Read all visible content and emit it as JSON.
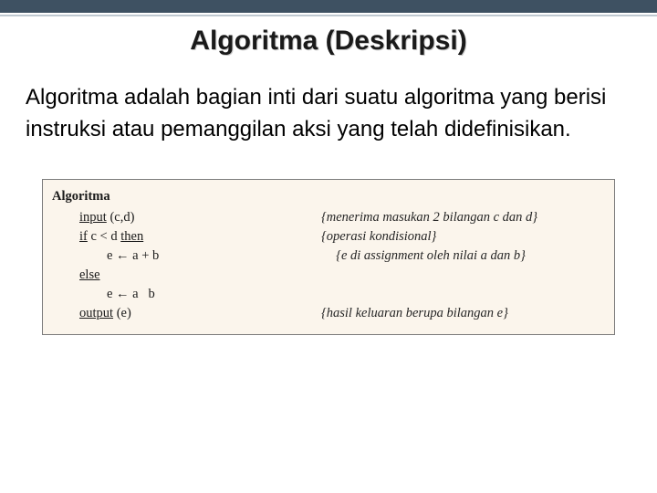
{
  "title": "Algoritma (Deskripsi)",
  "paragraph": "Algoritma adalah bagian inti dari suatu algoritma yang berisi instruksi atau pemanggilan aksi yang telah didefinisikan.",
  "code": {
    "header": "Algoritma",
    "lines": [
      {
        "kw": "input",
        "rest": " (c,d)",
        "comment": "{menerima masukan 2 bilangan c dan d}",
        "indent": 1
      },
      {
        "kw": "if",
        "rest": " c < d ",
        "kw2": "then",
        "comment": "{operasi kondisional}",
        "indent": 1
      },
      {
        "kw": "",
        "rest": "e ← a + b",
        "comment": "{e di assignment oleh nilai a dan b}",
        "indent": 2
      },
      {
        "kw": "else",
        "rest": "",
        "comment": "",
        "indent": 1
      },
      {
        "kw": "",
        "rest": "e ← a   b",
        "comment": "",
        "indent": 2
      },
      {
        "kw": "output",
        "rest": " (e)",
        "comment": "{hasil keluaran berupa bilangan e}",
        "indent": 1
      }
    ]
  }
}
